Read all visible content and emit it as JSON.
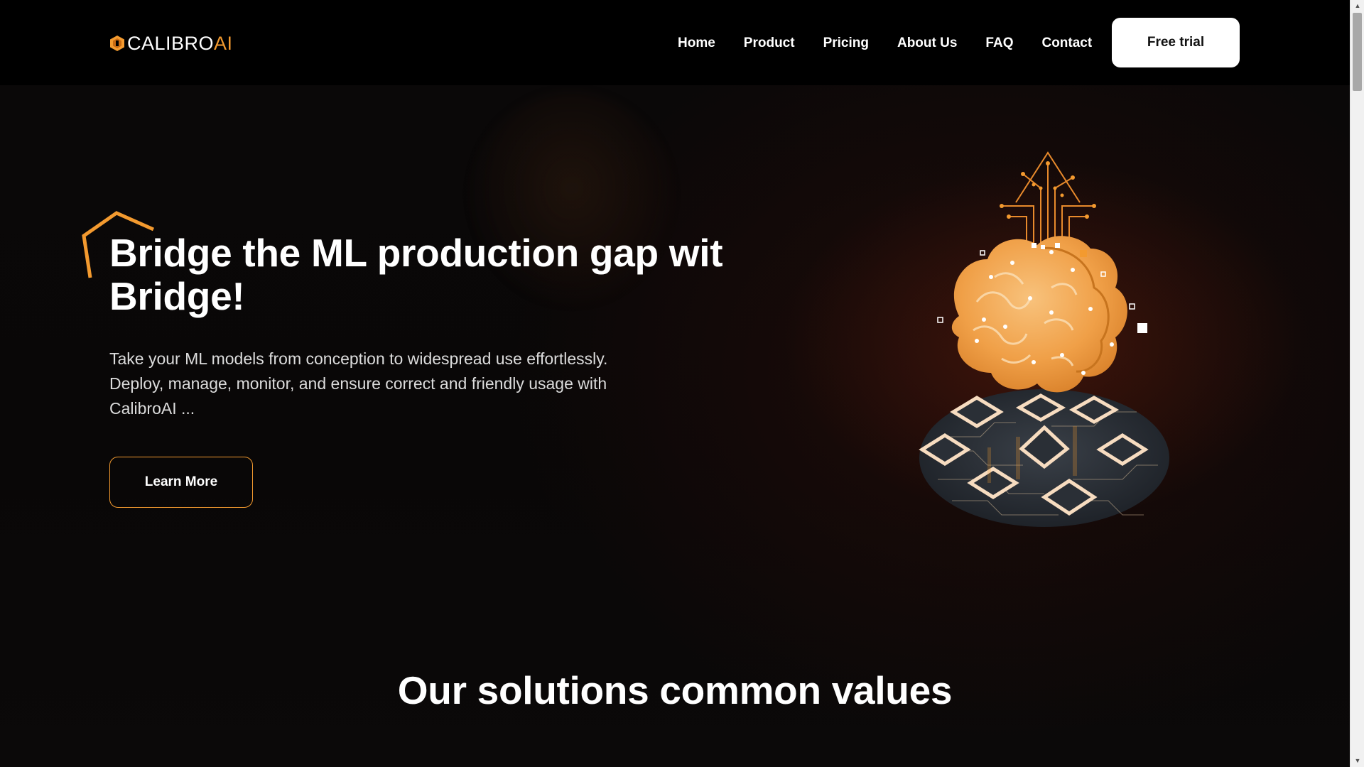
{
  "brand": {
    "name_main": "CALIBRO",
    "name_accent": "AI",
    "accent_color": "#f39a2f"
  },
  "nav": {
    "items": [
      {
        "label": "Home"
      },
      {
        "label": "Product"
      },
      {
        "label": "Pricing"
      },
      {
        "label": "About Us"
      },
      {
        "label": "FAQ"
      },
      {
        "label": "Contact"
      }
    ],
    "cta_label": "Free trial"
  },
  "hero": {
    "title": "Bridge the ML production gap wit Bridge!",
    "description": "Take your ML models from conception to widespread use effortlessly. Deploy, manage, monitor, and ensure correct and friendly usage with CalibroAI ...",
    "button_label": "Learn More",
    "illustration_icon": "brain-circuit-illustration"
  },
  "section": {
    "title": "Our solutions common values"
  },
  "scrollbar": {
    "up_icon": "scroll-up-arrow-icon",
    "down_icon": "scroll-down-arrow-icon"
  }
}
